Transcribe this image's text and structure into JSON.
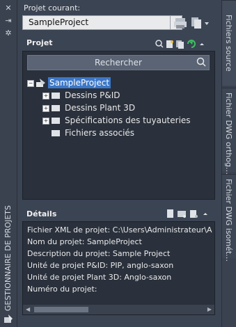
{
  "left_sidebar": {
    "vertical_title": "GESTIONNAIRE DE PROJETS"
  },
  "current_project": {
    "label": "Projet courant:",
    "selected": "SampleProject"
  },
  "projet_panel": {
    "title": "Projet",
    "search_placeholder": "Rechercher",
    "tree": {
      "root": "SampleProject",
      "children": [
        "Dessins P&ID",
        "Dessins Plant 3D",
        "Spécifications des tuyauteries",
        "Fichiers associés"
      ]
    }
  },
  "details_panel": {
    "title": "Détails",
    "lines": [
      "Fichier XML de projet: C:\\Users\\Administrateur\\A",
      "Nom du projet: SampleProject",
      "Description du projet: Sample Project",
      "Unité de projet P&ID: PIP, anglo-saxon",
      "Unité de projet Plant 3D: Anglo-saxon",
      "Numéro du projet:"
    ]
  },
  "right_tabs": [
    "Fichiers source",
    "Fichier DWG orthog…",
    "Fichier DWG isomét…"
  ]
}
